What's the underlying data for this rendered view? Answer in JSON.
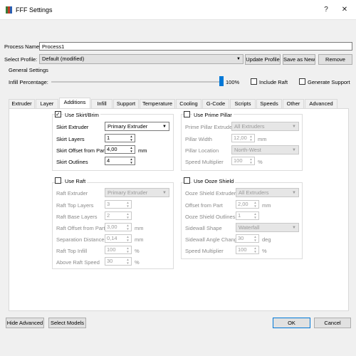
{
  "window": {
    "title": "FFF Settings",
    "help": "?",
    "close": "✕"
  },
  "process": {
    "label": "Process Name:",
    "value": "Process1"
  },
  "profile": {
    "label": "Select Profile:",
    "value": "Default (modified)",
    "update": "Update Profile",
    "save_as": "Save as New",
    "remove": "Remove"
  },
  "general": {
    "title": "General Settings",
    "infill_label": "Infill Percentage:",
    "infill_value": "100%",
    "infill_fraction": 1.0,
    "include_raft": "Include Raft",
    "generate_support": "Generate Support"
  },
  "tabs": [
    "Extruder",
    "Layer",
    "Additions",
    "Infill",
    "Support",
    "Temperature",
    "Cooling",
    "G-Code",
    "Scripts",
    "Speeds",
    "Other",
    "Advanced"
  ],
  "active_tab": "Additions",
  "skirt": {
    "title": "Use Skirt/Brim",
    "extruder_label": "Skirt Extruder",
    "extruder_value": "Primary Extruder",
    "layers_label": "Skirt Layers",
    "layers_value": "1",
    "offset_label": "Skirt Offset from Part",
    "offset_value": "4,00",
    "offset_unit": "mm",
    "outlines_label": "Skirt Outlines",
    "outlines_value": "4"
  },
  "prime": {
    "title": "Use Prime Pillar",
    "extruder_label": "Prime Pillar Extruder",
    "extruder_value": "All Extruders",
    "width_label": "Pillar Width",
    "width_value": "12,00",
    "width_unit": "mm",
    "location_label": "Pillar Location",
    "location_value": "North-West",
    "speed_label": "Speed Multiplier",
    "speed_value": "100",
    "speed_unit": "%"
  },
  "raft": {
    "title": "Use Raft",
    "extruder_label": "Raft Extruder",
    "extruder_value": "Primary Extruder",
    "top_label": "Raft Top Layers",
    "top_value": "3",
    "base_label": "Raft Base Layers",
    "base_value": "2",
    "offset_label": "Raft Offset from Part",
    "offset_value": "3,00",
    "offset_unit": "mm",
    "sep_label": "Separation Distance",
    "sep_value": "0,14",
    "sep_unit": "mm",
    "infill_label": "Raft Top Infill",
    "infill_value": "100",
    "infill_unit": "%",
    "speed_label": "Above Raft Speed",
    "speed_value": "30",
    "speed_unit": "%"
  },
  "ooze": {
    "title": "Use Ooze Shield",
    "extruder_label": "Ooze Shield Extruder",
    "extruder_value": "All Extruders",
    "offset_label": "Offset from Part",
    "offset_value": "2,00",
    "offset_unit": "mm",
    "outlines_label": "Ooze Shield Outlines",
    "outlines_value": "1",
    "shape_label": "Sidewall Shape",
    "shape_value": "Waterfall",
    "angle_label": "Sidewall Angle Change",
    "angle_value": "30",
    "angle_unit": "deg",
    "speed_label": "Speed Multiplier",
    "speed_value": "100",
    "speed_unit": "%"
  },
  "footer": {
    "hide_advanced": "Hide Advanced",
    "select_models": "Select Models",
    "ok": "OK",
    "cancel": "Cancel"
  },
  "colors": {
    "accent": "#0078d7"
  }
}
